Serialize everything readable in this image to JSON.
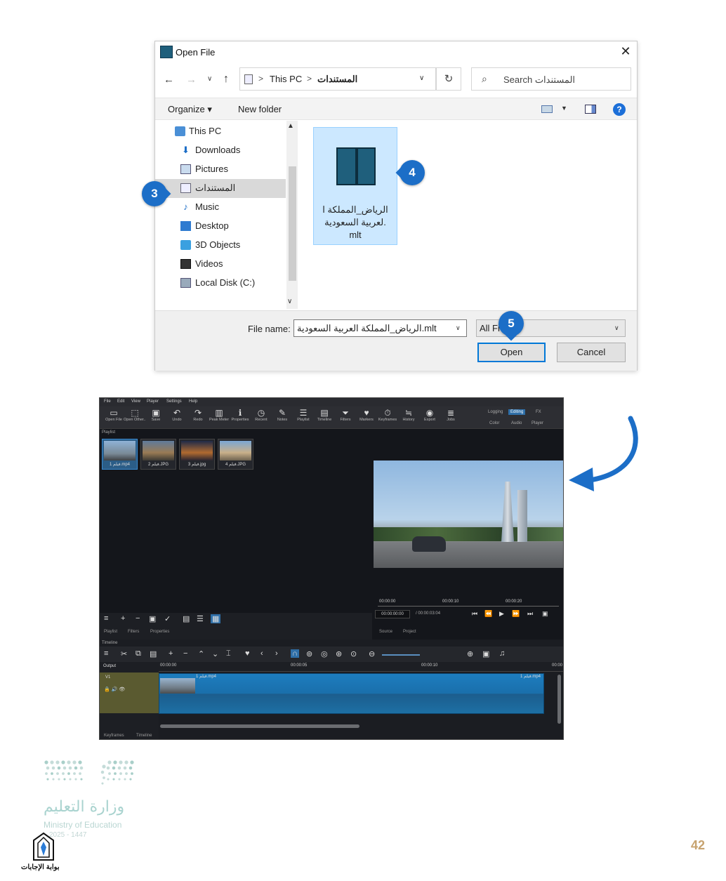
{
  "dialog": {
    "title": "Open File",
    "close": "✕",
    "address": {
      "root": "This PC",
      "sep": ">",
      "folder": "المستندات"
    },
    "search_placeholder": "Search المستندات",
    "toolbar": {
      "organize": "Organize ▾",
      "new_folder": "New folder",
      "help": "?"
    },
    "nav_items": [
      {
        "label": "This PC",
        "icon": "computer-icon"
      },
      {
        "label": "Downloads",
        "icon": "download-arrow-icon"
      },
      {
        "label": "Pictures",
        "icon": "pictures-icon"
      },
      {
        "label": "المستندات",
        "icon": "document-icon",
        "selected": true
      },
      {
        "label": "Music",
        "icon": "music-note-icon"
      },
      {
        "label": "Desktop",
        "icon": "desktop-icon"
      },
      {
        "label": "3D Objects",
        "icon": "cube-icon"
      },
      {
        "label": "Videos",
        "icon": "film-icon"
      },
      {
        "label": "Local Disk (C:)",
        "icon": "disk-drive-icon"
      }
    ],
    "file": {
      "name_line1": "الرياض_المملكة ا",
      "name_line2": "لعربية السعودية.",
      "name_line3": "mlt"
    },
    "file_name_label": "File name:",
    "file_name_value": "الرياض_المملكة العربية السعودية.mlt",
    "file_type": "All Fi",
    "open_button": "Open",
    "cancel_button": "Cancel"
  },
  "callouts": {
    "c3": "3",
    "c4": "4",
    "c5": "5"
  },
  "shotcut": {
    "menu": [
      "File",
      "Edit",
      "View",
      "Player",
      "Settings",
      "Help"
    ],
    "toolbar": [
      {
        "icon": "open-file-icon",
        "glyph": "▭",
        "label": "Open File"
      },
      {
        "icon": "open-other-icon",
        "glyph": "⬚",
        "label": "Open Other..."
      },
      {
        "icon": "save-icon",
        "glyph": "▣",
        "label": "Save"
      },
      {
        "icon": "undo-icon",
        "glyph": "↶",
        "label": "Undo"
      },
      {
        "icon": "redo-icon",
        "glyph": "↷",
        "label": "Redo"
      },
      {
        "icon": "peak-meter-icon",
        "glyph": "▥",
        "label": "Peak Meter"
      },
      {
        "icon": "properties-icon",
        "glyph": "ℹ",
        "label": "Properties"
      },
      {
        "icon": "recent-icon",
        "glyph": "◷",
        "label": "Recent"
      },
      {
        "icon": "notes-icon",
        "glyph": "✎",
        "label": "Notes"
      },
      {
        "icon": "playlist-icon",
        "glyph": "☰",
        "label": "Playlist"
      },
      {
        "icon": "timeline-icon",
        "glyph": "▤",
        "label": "Timeline"
      },
      {
        "icon": "filters-icon",
        "glyph": "⏷",
        "label": "Filters"
      },
      {
        "icon": "markers-icon",
        "glyph": "♥",
        "label": "Markers"
      },
      {
        "icon": "keyframes-icon",
        "glyph": "⏱",
        "label": "Keyframes"
      },
      {
        "icon": "history-icon",
        "glyph": "≒",
        "label": "History"
      },
      {
        "icon": "export-icon",
        "glyph": "◉",
        "label": "Export"
      },
      {
        "icon": "jobs-icon",
        "glyph": "≣",
        "label": "Jobs"
      }
    ],
    "layouts": {
      "logging": "Logging",
      "editing": "Editing",
      "fx": "FX",
      "color": "Color",
      "audio": "Audio",
      "player": "Player"
    },
    "playlist_label": "Playlist",
    "thumbs": [
      "1 فيلم.mp4",
      "2 فيلم.JPG",
      "3 فيلم.jpg",
      "4 فيلم.JPG"
    ],
    "playlist_tabs": [
      "Playlist",
      "Filters",
      "Properties"
    ],
    "ruler": [
      "00:00:00",
      "00:00:10",
      "00:00:20"
    ],
    "timecode_current": "00:00:00:00",
    "timecode_total": "/ 00:00:03:04",
    "source_tabs": [
      "Source",
      "Project"
    ],
    "timeline_label": "Timeline",
    "output_label": "Output",
    "track_label": "V1",
    "tl_ruler": [
      "00:00:00",
      "00:00:05",
      "00:00:10",
      "00:00"
    ],
    "clip_label": "فيلم 1.mp4",
    "bottom_tabs": [
      "Keyframes",
      "Timeline"
    ]
  },
  "footer": {
    "moe_arabic": "وزارة التعليم",
    "moe_english": "Ministry of Education",
    "moe_year": "2025 - 1447",
    "portal": "بوابة الإجابات",
    "page_number": "42"
  },
  "colors": {
    "callout": "#1c6ec7",
    "selection": "#cce8ff",
    "accent": "#0078d7"
  }
}
